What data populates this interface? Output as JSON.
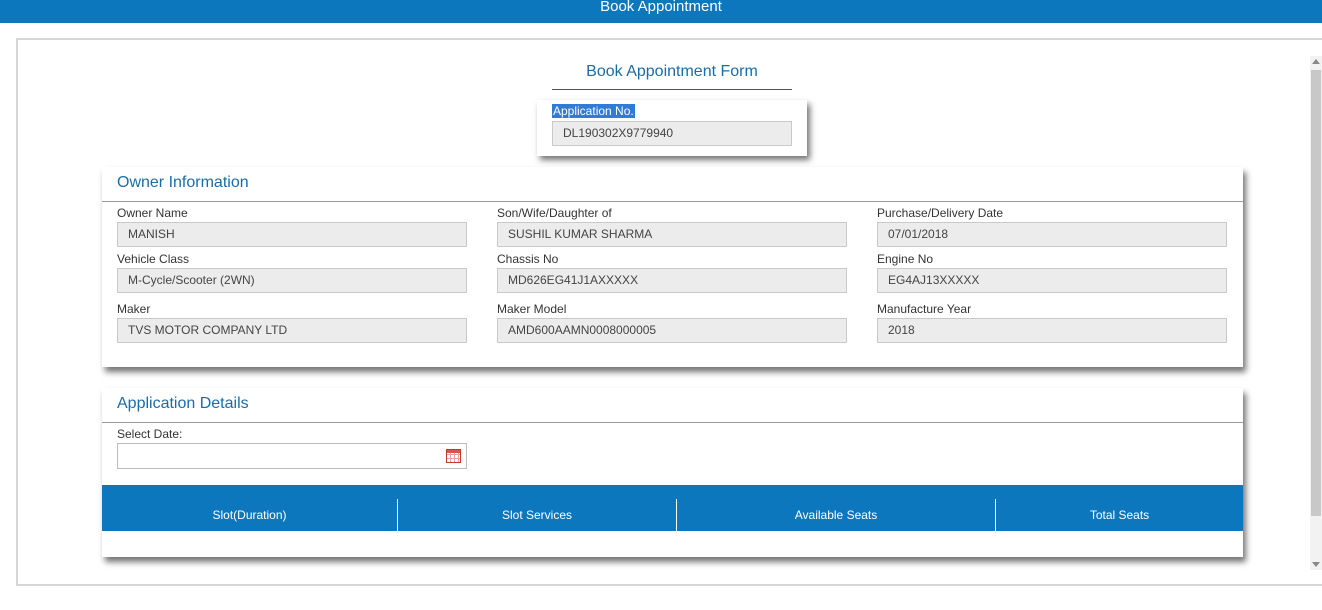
{
  "header": {
    "title": "Book Appointment"
  },
  "form": {
    "title": "Book Appointment Form",
    "application_no_label": "Application No.",
    "application_no_value": "DL190302X9779940"
  },
  "owner_info": {
    "title": "Owner Information",
    "fields": {
      "owner_name": {
        "label": "Owner Name",
        "value": "MANISH"
      },
      "relation": {
        "label": "Son/Wife/Daughter of",
        "value": "SUSHIL KUMAR SHARMA"
      },
      "purchase_date": {
        "label": "Purchase/Delivery Date",
        "value": "07/01/2018"
      },
      "vehicle_class": {
        "label": "Vehicle Class",
        "value": "M-Cycle/Scooter (2WN)"
      },
      "chassis_no": {
        "label": "Chassis No",
        "value": "MD626EG41J1AXXXXX"
      },
      "engine_no": {
        "label": "Engine No",
        "value": "EG4AJ13XXXXX"
      },
      "maker": {
        "label": "Maker",
        "value": "TVS MOTOR COMPANY LTD"
      },
      "maker_model": {
        "label": "Maker Model",
        "value": "AMD600AAMN0008000005"
      },
      "manufacture_year": {
        "label": "Manufacture Year",
        "value": "2018"
      }
    }
  },
  "application_details": {
    "title": "Application Details",
    "select_date_label": "Select Date:",
    "select_date_value": "",
    "calendar_icon": "calendar-icon",
    "slot_table": {
      "columns": [
        "Slot(Duration)",
        "Slot Services",
        "Available Seats",
        "Total Seats"
      ]
    }
  },
  "colors": {
    "primary": "#0c77bc",
    "heading": "#1a6ca8",
    "field_bg": "#ececec"
  }
}
